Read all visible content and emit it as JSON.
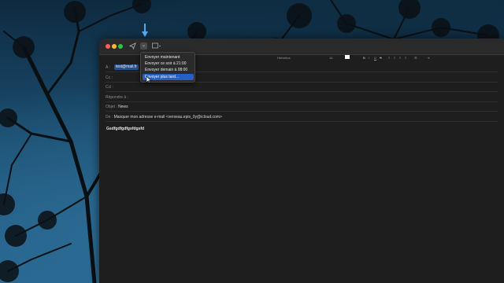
{
  "colors": {
    "accent_selection": "#2460c9",
    "annotation_arrow": "#5aa8e6",
    "recipient_chip": "#2a4f86"
  },
  "toolbar": {
    "send_icon": "paper-plane-icon",
    "send_options_icon": "chevron-down-icon",
    "attach_header_icon": "envelope-header-icon",
    "format": {
      "font_name": "Helvetica",
      "font_size": "14",
      "bold": "B",
      "italic": "I",
      "underline": "U",
      "strike": "S"
    }
  },
  "send_menu": {
    "items": [
      {
        "label": "Envoyer maintenant"
      },
      {
        "label": "Envoyer ce soir à 21:00"
      },
      {
        "label": "Envoyer demain à 08:00"
      },
      {
        "label": "Envoyer plus tard…"
      }
    ],
    "selected_index": 3
  },
  "fields": {
    "to_label": "À :",
    "to_value": "test@mail.fr",
    "cc_label": "Cc :",
    "bcc_label": "Cci :",
    "reply_to_label": "Répondre à :",
    "subject_label": "Objet :",
    "subject_value": "News",
    "from_label": "De :",
    "from_value": "Masquer mon adresse e-mail <verseau.epis_0y@icloud.com>"
  },
  "body": {
    "text": "Gsdfgdfgdfgsfdgsfd"
  }
}
